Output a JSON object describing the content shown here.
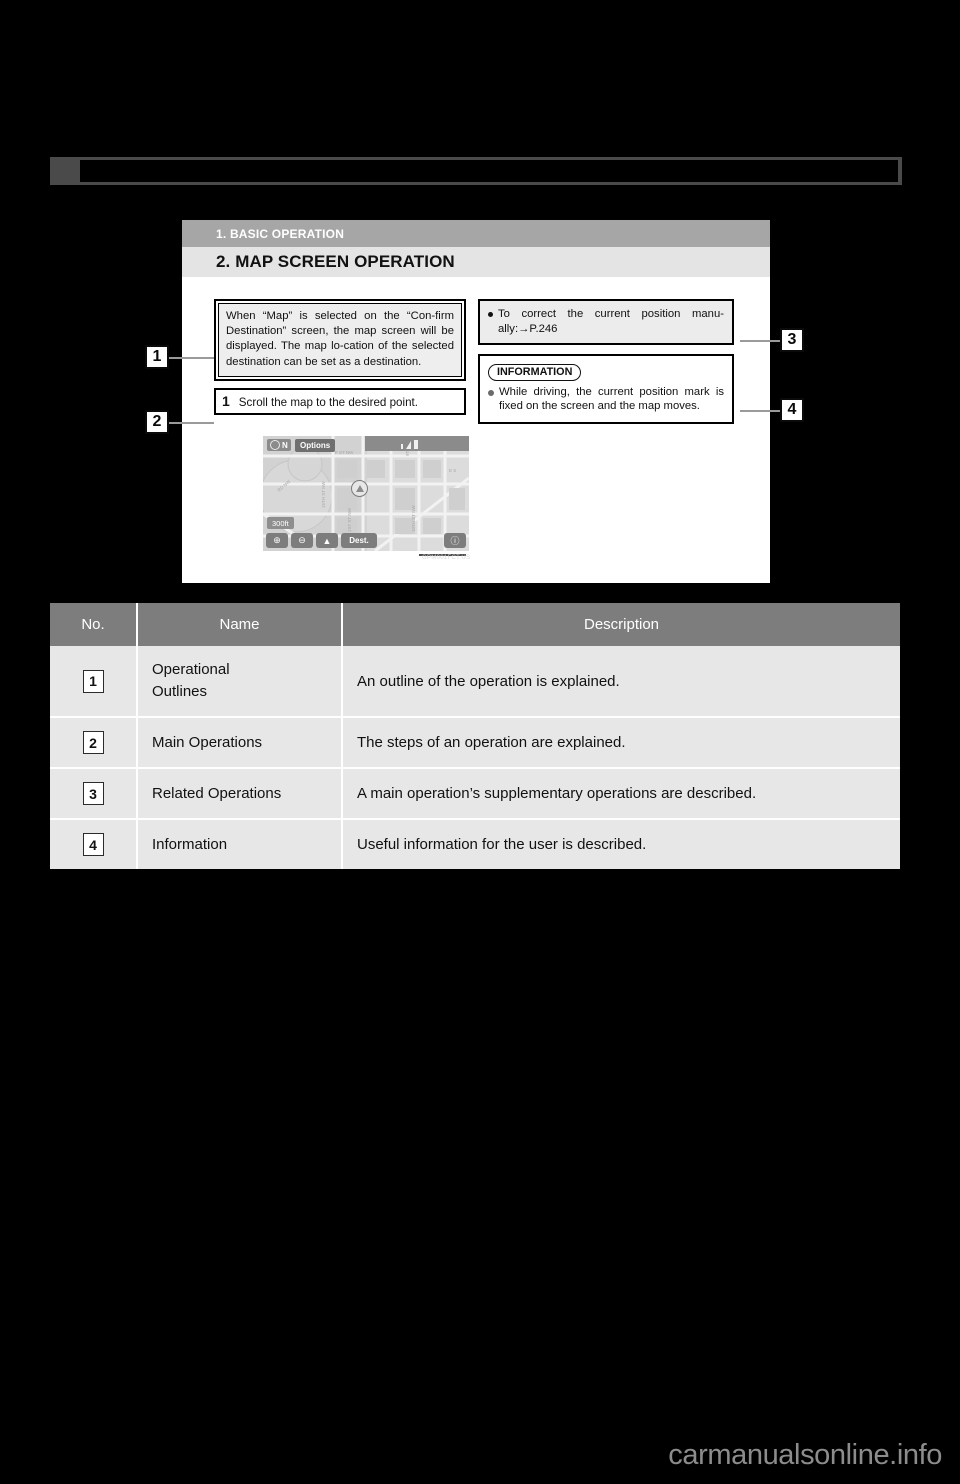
{
  "document": {
    "watermark": "carmanualsonline.info"
  },
  "sample_page": {
    "section_banner": "1. BASIC OPERATION",
    "title_banner": "2. MAP SCREEN OPERATION",
    "operational_outline": "When “Map” is selected on the “Con-firm Destination” screen, the map screen will be displayed. The map lo-cation of the selected destination can be set as a destination.",
    "main_operation": {
      "step_number": "1",
      "step_text": "Scroll the map to the desired point."
    },
    "related_operation": "To correct the current position manu-ally:→P.246",
    "information": {
      "label": "INFORMATION",
      "text": "While driving, the current position mark is fixed on the screen and the map moves."
    },
    "nav_screenshot": {
      "compass_label": "N",
      "options_button": "Options",
      "scale_label": "300ft",
      "zoom_in_icon": "⊕",
      "zoom_out_icon": "⊖",
      "current_position_icon": "▲",
      "dest_button": "Dest.",
      "info_button_icon": "ⓘ",
      "figure_code": "GPM001FCT.US"
    },
    "callouts": [
      {
        "number": "1"
      },
      {
        "number": "2"
      },
      {
        "number": "3"
      },
      {
        "number": "4"
      }
    ]
  },
  "legend_table": {
    "headers": {
      "no": "No.",
      "name": "Name",
      "description": "Description"
    },
    "rows": [
      {
        "no": "1",
        "name_line1": "Operational",
        "name_line2": "Outlines",
        "description": "An outline of the operation is explained."
      },
      {
        "no": "2",
        "name_line1": "Main Operations",
        "name_line2": "",
        "description": "The steps of an operation are explained."
      },
      {
        "no": "3",
        "name_line1": "Related Operations",
        "name_line2": "",
        "description": "A main operation’s supplementary operations are described."
      },
      {
        "no": "4",
        "name_line1": "Information",
        "name_line2": "",
        "description": "Useful information for the user is described."
      }
    ]
  },
  "colors": {
    "page_background": "#000000",
    "banner_gray": "#a6a6a6",
    "banner_light": "#e4e4e4",
    "table_header": "#7d7d7d",
    "table_row": "#e7e7e7"
  }
}
